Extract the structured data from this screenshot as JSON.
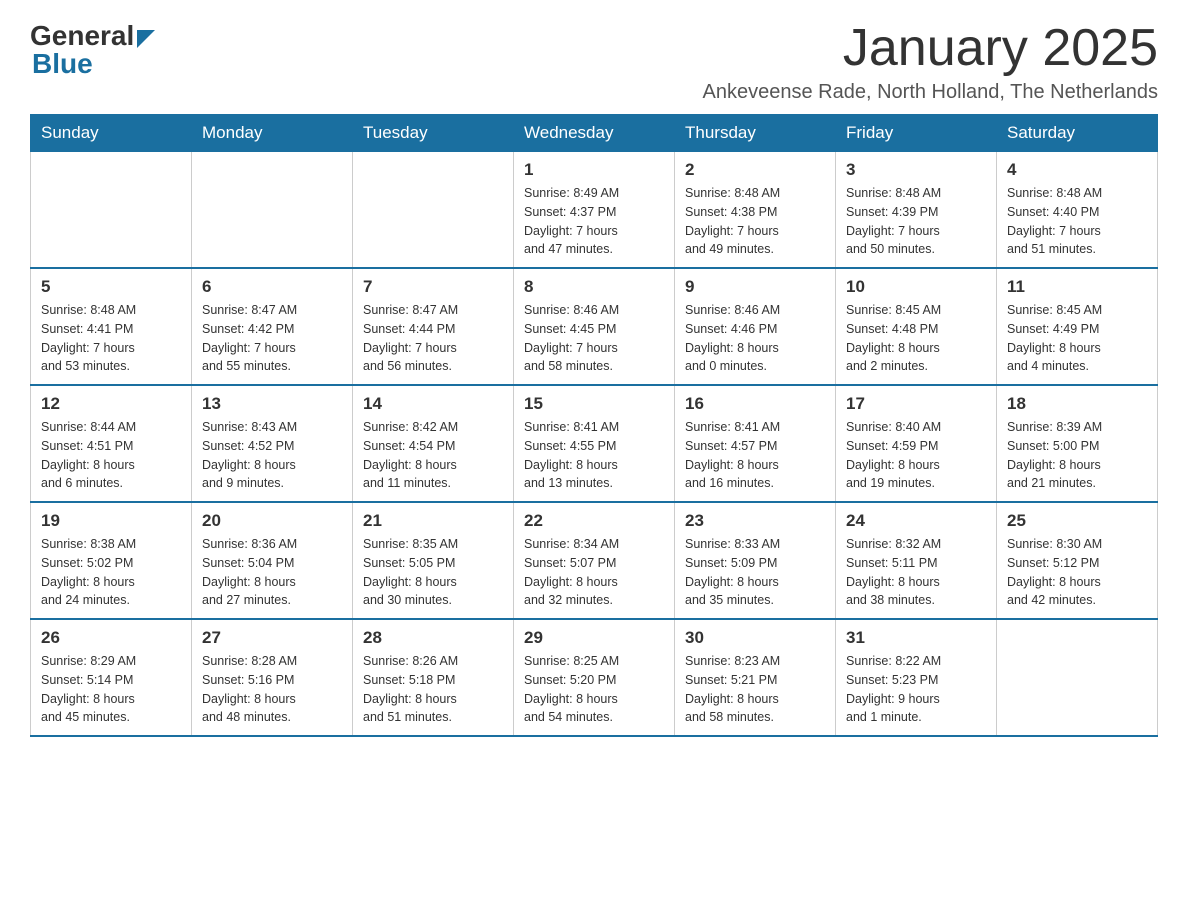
{
  "logo": {
    "general": "General",
    "arrow": "",
    "blue": "Blue"
  },
  "title": "January 2025",
  "location": "Ankeveense Rade, North Holland, The Netherlands",
  "days_of_week": [
    "Sunday",
    "Monday",
    "Tuesday",
    "Wednesday",
    "Thursday",
    "Friday",
    "Saturday"
  ],
  "weeks": [
    [
      {
        "day": "",
        "info": ""
      },
      {
        "day": "",
        "info": ""
      },
      {
        "day": "",
        "info": ""
      },
      {
        "day": "1",
        "info": "Sunrise: 8:49 AM\nSunset: 4:37 PM\nDaylight: 7 hours\nand 47 minutes."
      },
      {
        "day": "2",
        "info": "Sunrise: 8:48 AM\nSunset: 4:38 PM\nDaylight: 7 hours\nand 49 minutes."
      },
      {
        "day": "3",
        "info": "Sunrise: 8:48 AM\nSunset: 4:39 PM\nDaylight: 7 hours\nand 50 minutes."
      },
      {
        "day": "4",
        "info": "Sunrise: 8:48 AM\nSunset: 4:40 PM\nDaylight: 7 hours\nand 51 minutes."
      }
    ],
    [
      {
        "day": "5",
        "info": "Sunrise: 8:48 AM\nSunset: 4:41 PM\nDaylight: 7 hours\nand 53 minutes."
      },
      {
        "day": "6",
        "info": "Sunrise: 8:47 AM\nSunset: 4:42 PM\nDaylight: 7 hours\nand 55 minutes."
      },
      {
        "day": "7",
        "info": "Sunrise: 8:47 AM\nSunset: 4:44 PM\nDaylight: 7 hours\nand 56 minutes."
      },
      {
        "day": "8",
        "info": "Sunrise: 8:46 AM\nSunset: 4:45 PM\nDaylight: 7 hours\nand 58 minutes."
      },
      {
        "day": "9",
        "info": "Sunrise: 8:46 AM\nSunset: 4:46 PM\nDaylight: 8 hours\nand 0 minutes."
      },
      {
        "day": "10",
        "info": "Sunrise: 8:45 AM\nSunset: 4:48 PM\nDaylight: 8 hours\nand 2 minutes."
      },
      {
        "day": "11",
        "info": "Sunrise: 8:45 AM\nSunset: 4:49 PM\nDaylight: 8 hours\nand 4 minutes."
      }
    ],
    [
      {
        "day": "12",
        "info": "Sunrise: 8:44 AM\nSunset: 4:51 PM\nDaylight: 8 hours\nand 6 minutes."
      },
      {
        "day": "13",
        "info": "Sunrise: 8:43 AM\nSunset: 4:52 PM\nDaylight: 8 hours\nand 9 minutes."
      },
      {
        "day": "14",
        "info": "Sunrise: 8:42 AM\nSunset: 4:54 PM\nDaylight: 8 hours\nand 11 minutes."
      },
      {
        "day": "15",
        "info": "Sunrise: 8:41 AM\nSunset: 4:55 PM\nDaylight: 8 hours\nand 13 minutes."
      },
      {
        "day": "16",
        "info": "Sunrise: 8:41 AM\nSunset: 4:57 PM\nDaylight: 8 hours\nand 16 minutes."
      },
      {
        "day": "17",
        "info": "Sunrise: 8:40 AM\nSunset: 4:59 PM\nDaylight: 8 hours\nand 19 minutes."
      },
      {
        "day": "18",
        "info": "Sunrise: 8:39 AM\nSunset: 5:00 PM\nDaylight: 8 hours\nand 21 minutes."
      }
    ],
    [
      {
        "day": "19",
        "info": "Sunrise: 8:38 AM\nSunset: 5:02 PM\nDaylight: 8 hours\nand 24 minutes."
      },
      {
        "day": "20",
        "info": "Sunrise: 8:36 AM\nSunset: 5:04 PM\nDaylight: 8 hours\nand 27 minutes."
      },
      {
        "day": "21",
        "info": "Sunrise: 8:35 AM\nSunset: 5:05 PM\nDaylight: 8 hours\nand 30 minutes."
      },
      {
        "day": "22",
        "info": "Sunrise: 8:34 AM\nSunset: 5:07 PM\nDaylight: 8 hours\nand 32 minutes."
      },
      {
        "day": "23",
        "info": "Sunrise: 8:33 AM\nSunset: 5:09 PM\nDaylight: 8 hours\nand 35 minutes."
      },
      {
        "day": "24",
        "info": "Sunrise: 8:32 AM\nSunset: 5:11 PM\nDaylight: 8 hours\nand 38 minutes."
      },
      {
        "day": "25",
        "info": "Sunrise: 8:30 AM\nSunset: 5:12 PM\nDaylight: 8 hours\nand 42 minutes."
      }
    ],
    [
      {
        "day": "26",
        "info": "Sunrise: 8:29 AM\nSunset: 5:14 PM\nDaylight: 8 hours\nand 45 minutes."
      },
      {
        "day": "27",
        "info": "Sunrise: 8:28 AM\nSunset: 5:16 PM\nDaylight: 8 hours\nand 48 minutes."
      },
      {
        "day": "28",
        "info": "Sunrise: 8:26 AM\nSunset: 5:18 PM\nDaylight: 8 hours\nand 51 minutes."
      },
      {
        "day": "29",
        "info": "Sunrise: 8:25 AM\nSunset: 5:20 PM\nDaylight: 8 hours\nand 54 minutes."
      },
      {
        "day": "30",
        "info": "Sunrise: 8:23 AM\nSunset: 5:21 PM\nDaylight: 8 hours\nand 58 minutes."
      },
      {
        "day": "31",
        "info": "Sunrise: 8:22 AM\nSunset: 5:23 PM\nDaylight: 9 hours\nand 1 minute."
      },
      {
        "day": "",
        "info": ""
      }
    ]
  ]
}
